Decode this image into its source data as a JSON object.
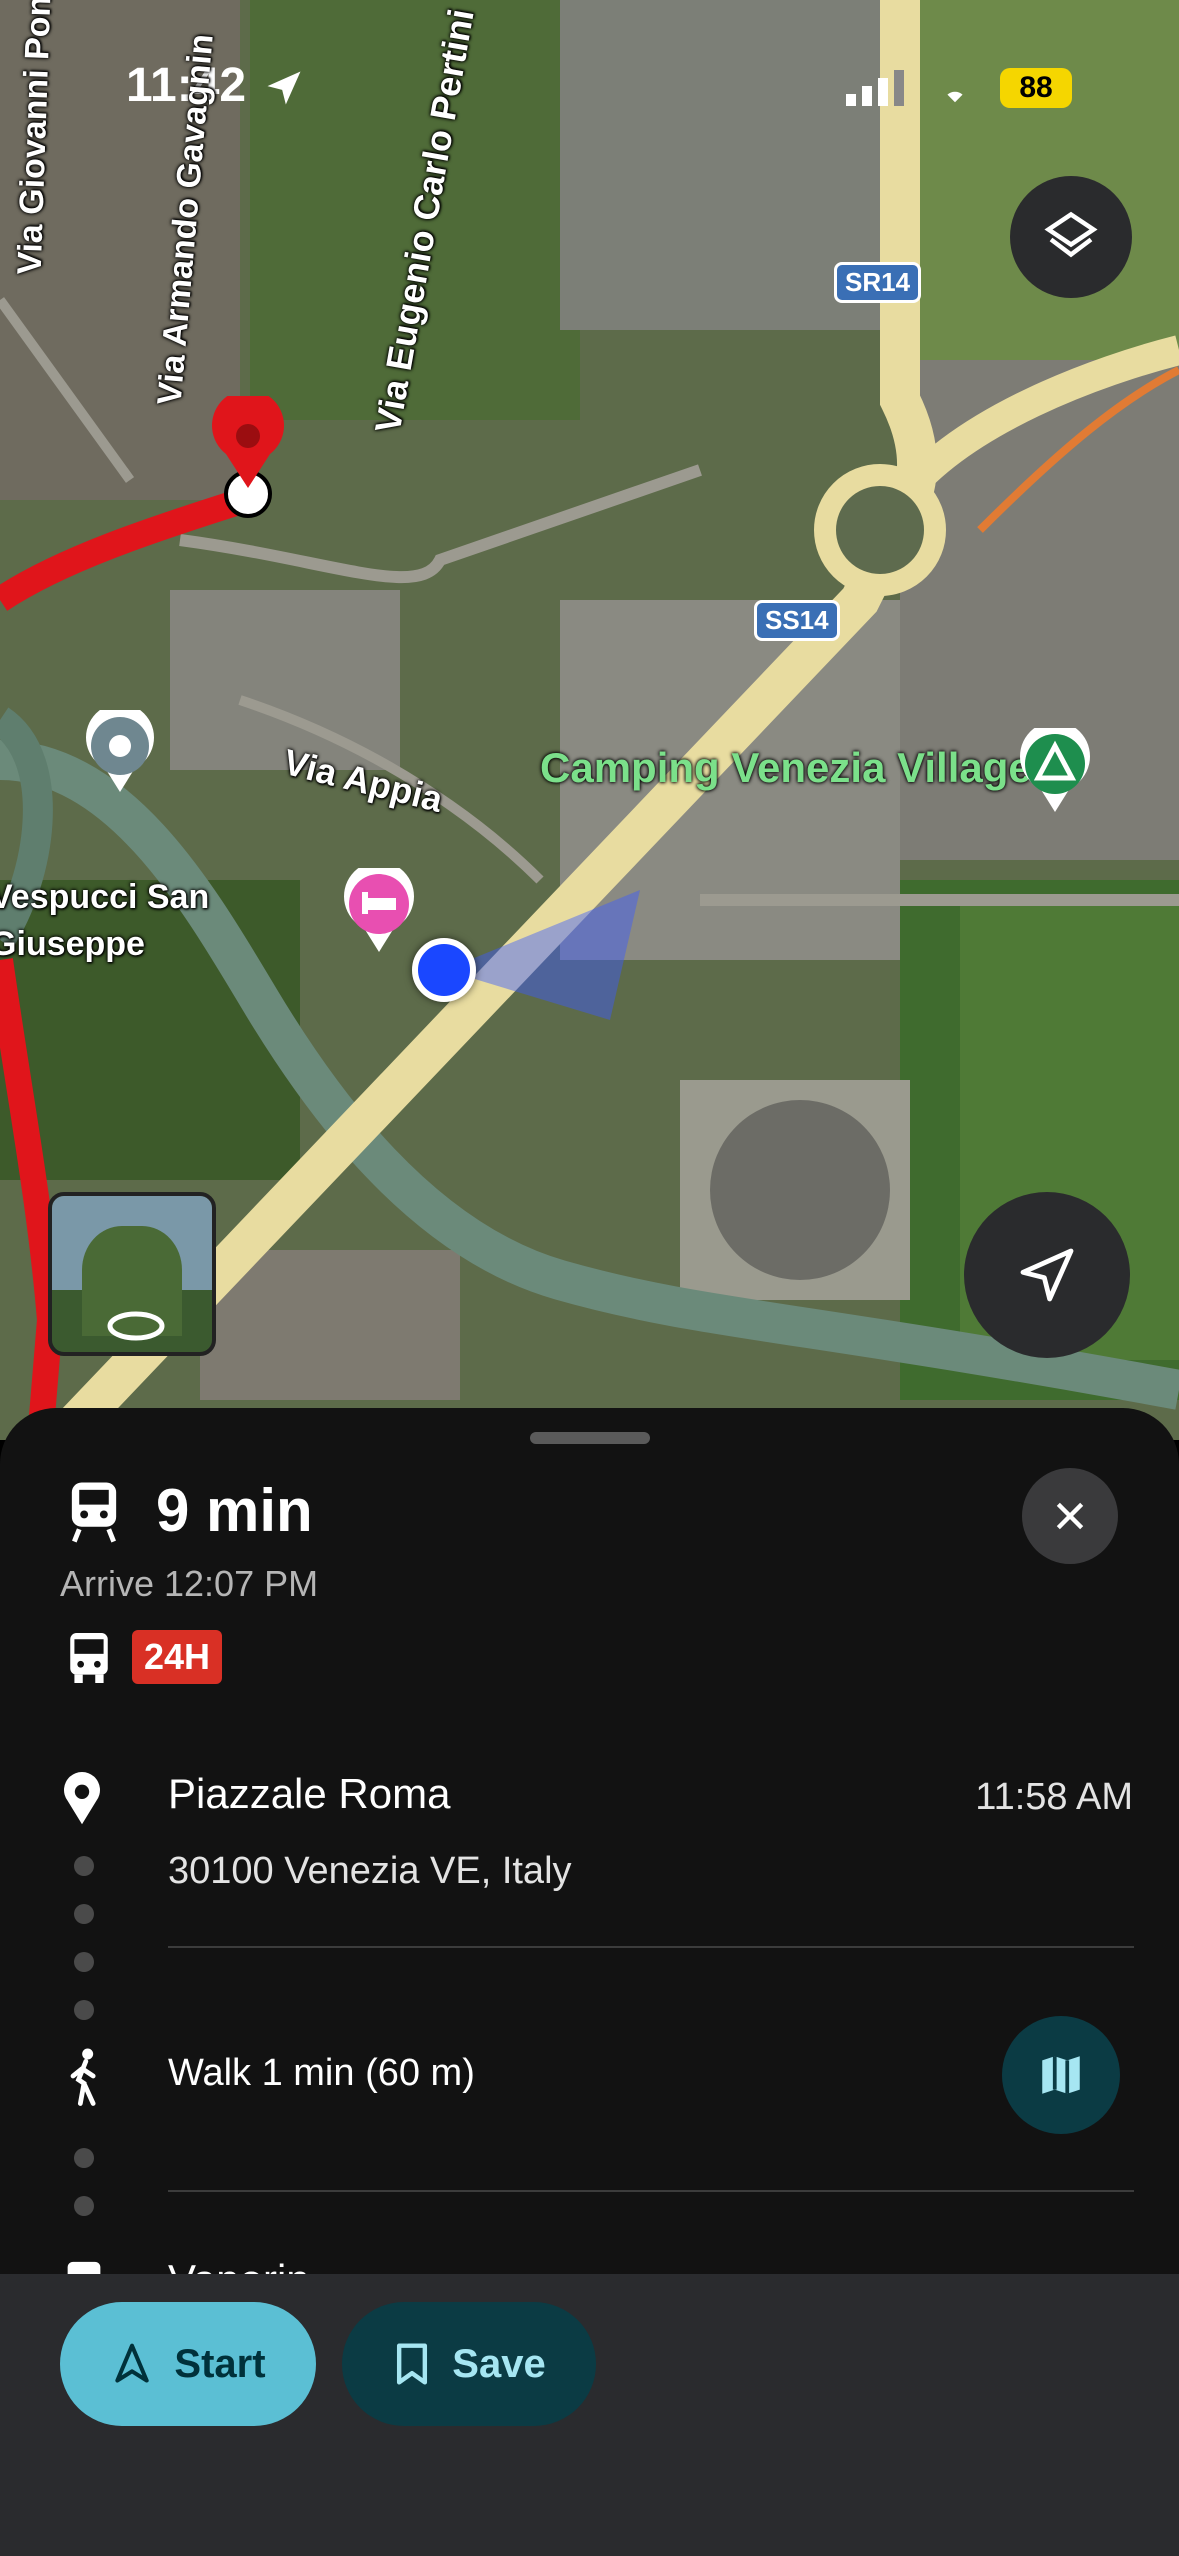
{
  "status_bar": {
    "time": "11:42",
    "battery": "88"
  },
  "map": {
    "street_labels": {
      "via_giovanni": "Via Giovanni Pont",
      "via_armando": "Via Armando Gavagnin",
      "via_eugenio": "Via Eugenio Carlo Pertini",
      "via_appia": "Via Appia",
      "vespucci": "Vespucci San",
      "giuseppe": "Giuseppe"
    },
    "poi": {
      "camping": "Camping Venezia Village"
    },
    "shields": {
      "sr14": "SR14",
      "ss14": "SS14"
    }
  },
  "route_summary": {
    "duration": "9 min",
    "arrive": "Arrive 12:07 PM",
    "badge": "24H"
  },
  "steps": {
    "origin": {
      "title": "Piazzale Roma",
      "address": "30100 Venezia VE, Italy",
      "time": "11:58 AM"
    },
    "walk": {
      "label": "Walk 1 min (60 m)"
    },
    "partial": {
      "label": "Vaporin"
    }
  },
  "actions": {
    "start": "Start",
    "save": "Save"
  },
  "colors": {
    "accent": "#5bbfd4",
    "route": "#e0151b",
    "badge": "#d93025"
  }
}
